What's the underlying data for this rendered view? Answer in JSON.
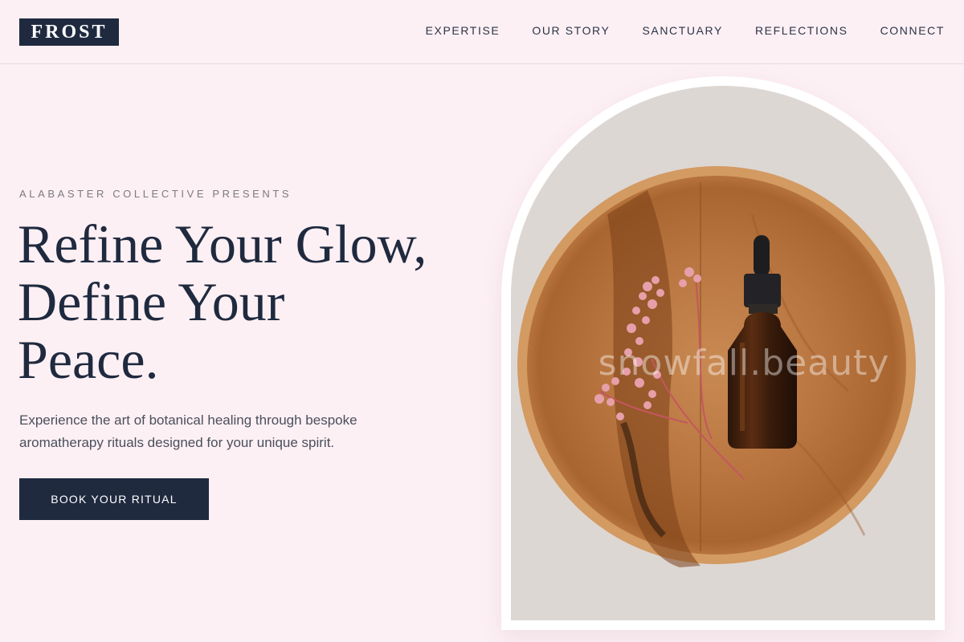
{
  "brand": {
    "logo_text": "FROST"
  },
  "nav": {
    "items": [
      {
        "label": "EXPERTISE"
      },
      {
        "label": "OUR STORY"
      },
      {
        "label": "SANCTUARY"
      },
      {
        "label": "REFLECTIONS"
      },
      {
        "label": "CONNECT"
      }
    ]
  },
  "hero": {
    "eyebrow": "ALABASTER COLLECTIVE PRESENTS",
    "headline_lines": [
      "Refine Your Glow,",
      "Define Your",
      "Peace."
    ],
    "subtext": "Experience the art of botanical healing through bespoke aromatherapy rituals designed for your unique spirit.",
    "cta_label": "BOOK YOUR RITUAL",
    "image_watermark": "snowfall.beauty"
  },
  "colors": {
    "background": "#fdf0f4",
    "primary": "#1f2a3f",
    "frame": "#ffffff"
  }
}
